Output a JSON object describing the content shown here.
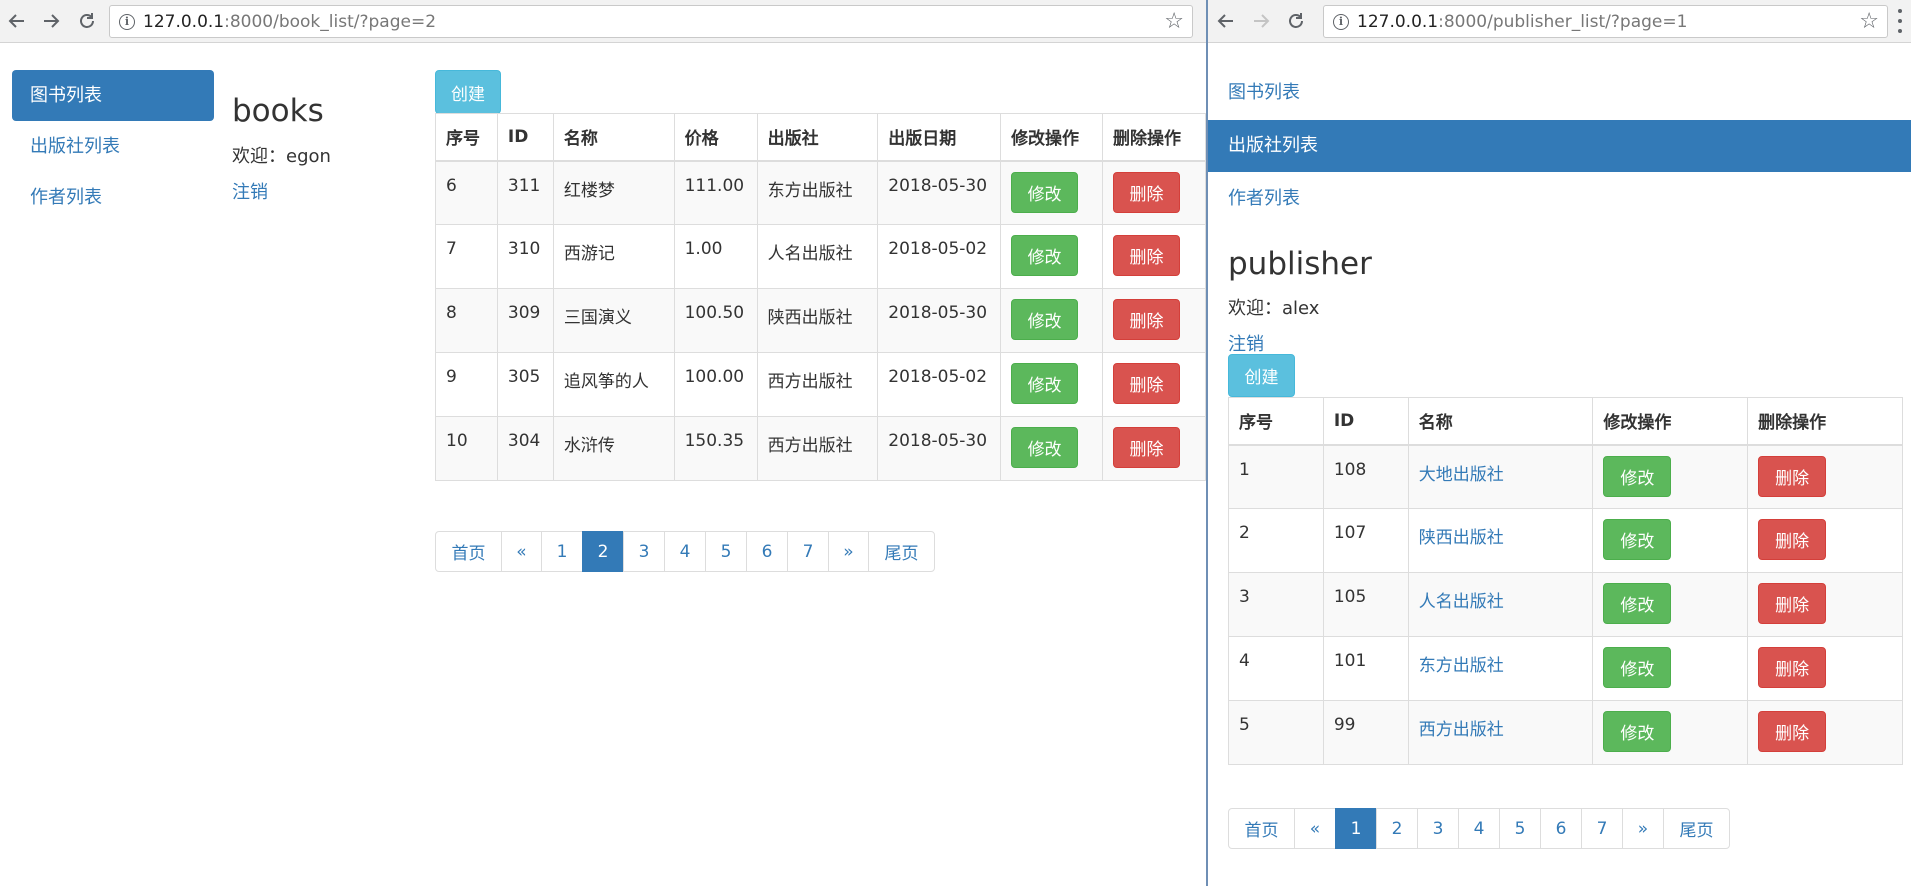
{
  "left": {
    "url_host": "127.0.0.1",
    "url_rest": ":8000/book_list/?page=2",
    "nav": [
      "图书列表",
      "出版社列表",
      "作者列表"
    ],
    "title": "books",
    "welcome": "欢迎：egon",
    "logout": "注销",
    "create": "创建",
    "headers": [
      "序号",
      "ID",
      "名称",
      "价格",
      "出版社",
      "出版日期",
      "修改操作",
      "删除操作"
    ],
    "rows": [
      {
        "no": "6",
        "id": "311",
        "name": "红楼梦",
        "price": "111.00",
        "publisher": "东方出版社",
        "date": "2018-05-30"
      },
      {
        "no": "7",
        "id": "310",
        "name": "西游记",
        "price": "1.00",
        "publisher": "人名出版社",
        "date": "2018-05-02"
      },
      {
        "no": "8",
        "id": "309",
        "name": "三国演义",
        "price": "100.50",
        "publisher": "陕西出版社",
        "date": "2018-05-30"
      },
      {
        "no": "9",
        "id": "305",
        "name": "追风筝的人",
        "price": "100.00",
        "publisher": "西方出版社",
        "date": "2018-05-02"
      },
      {
        "no": "10",
        "id": "304",
        "name": "水浒传",
        "price": "150.35",
        "publisher": "西方出版社",
        "date": "2018-05-30"
      }
    ],
    "edit": "修改",
    "delete": "删除",
    "pager": [
      "首页",
      "«",
      "1",
      "2",
      "3",
      "4",
      "5",
      "6",
      "7",
      "»",
      "尾页"
    ],
    "current_page": "2"
  },
  "right": {
    "url_host": "127.0.0.1",
    "url_rest": ":8000/publisher_list/?page=1",
    "nav": [
      "图书列表",
      "出版社列表",
      "作者列表"
    ],
    "title": "publisher",
    "welcome": "欢迎：alex",
    "logout": "注销",
    "create": "创建",
    "headers": [
      "序号",
      "ID",
      "名称",
      "修改操作",
      "删除操作"
    ],
    "rows": [
      {
        "no": "1",
        "id": "108",
        "name": "大地出版社"
      },
      {
        "no": "2",
        "id": "107",
        "name": "陕西出版社"
      },
      {
        "no": "3",
        "id": "105",
        "name": "人名出版社"
      },
      {
        "no": "4",
        "id": "101",
        "name": "东方出版社"
      },
      {
        "no": "5",
        "id": "99",
        "name": "西方出版社"
      }
    ],
    "edit": "修改",
    "delete": "删除",
    "pager": [
      "首页",
      "«",
      "1",
      "2",
      "3",
      "4",
      "5",
      "6",
      "7",
      "»",
      "尾页"
    ],
    "current_page": "1"
  },
  "colors": {
    "primary": "#337ab7",
    "info": "#5bc0de",
    "success": "#5cb85c",
    "danger": "#d9534f"
  },
  "icons": [
    "back-arrow-icon",
    "forward-arrow-icon",
    "reload-icon",
    "info-icon",
    "star-icon",
    "menu-icon"
  ]
}
